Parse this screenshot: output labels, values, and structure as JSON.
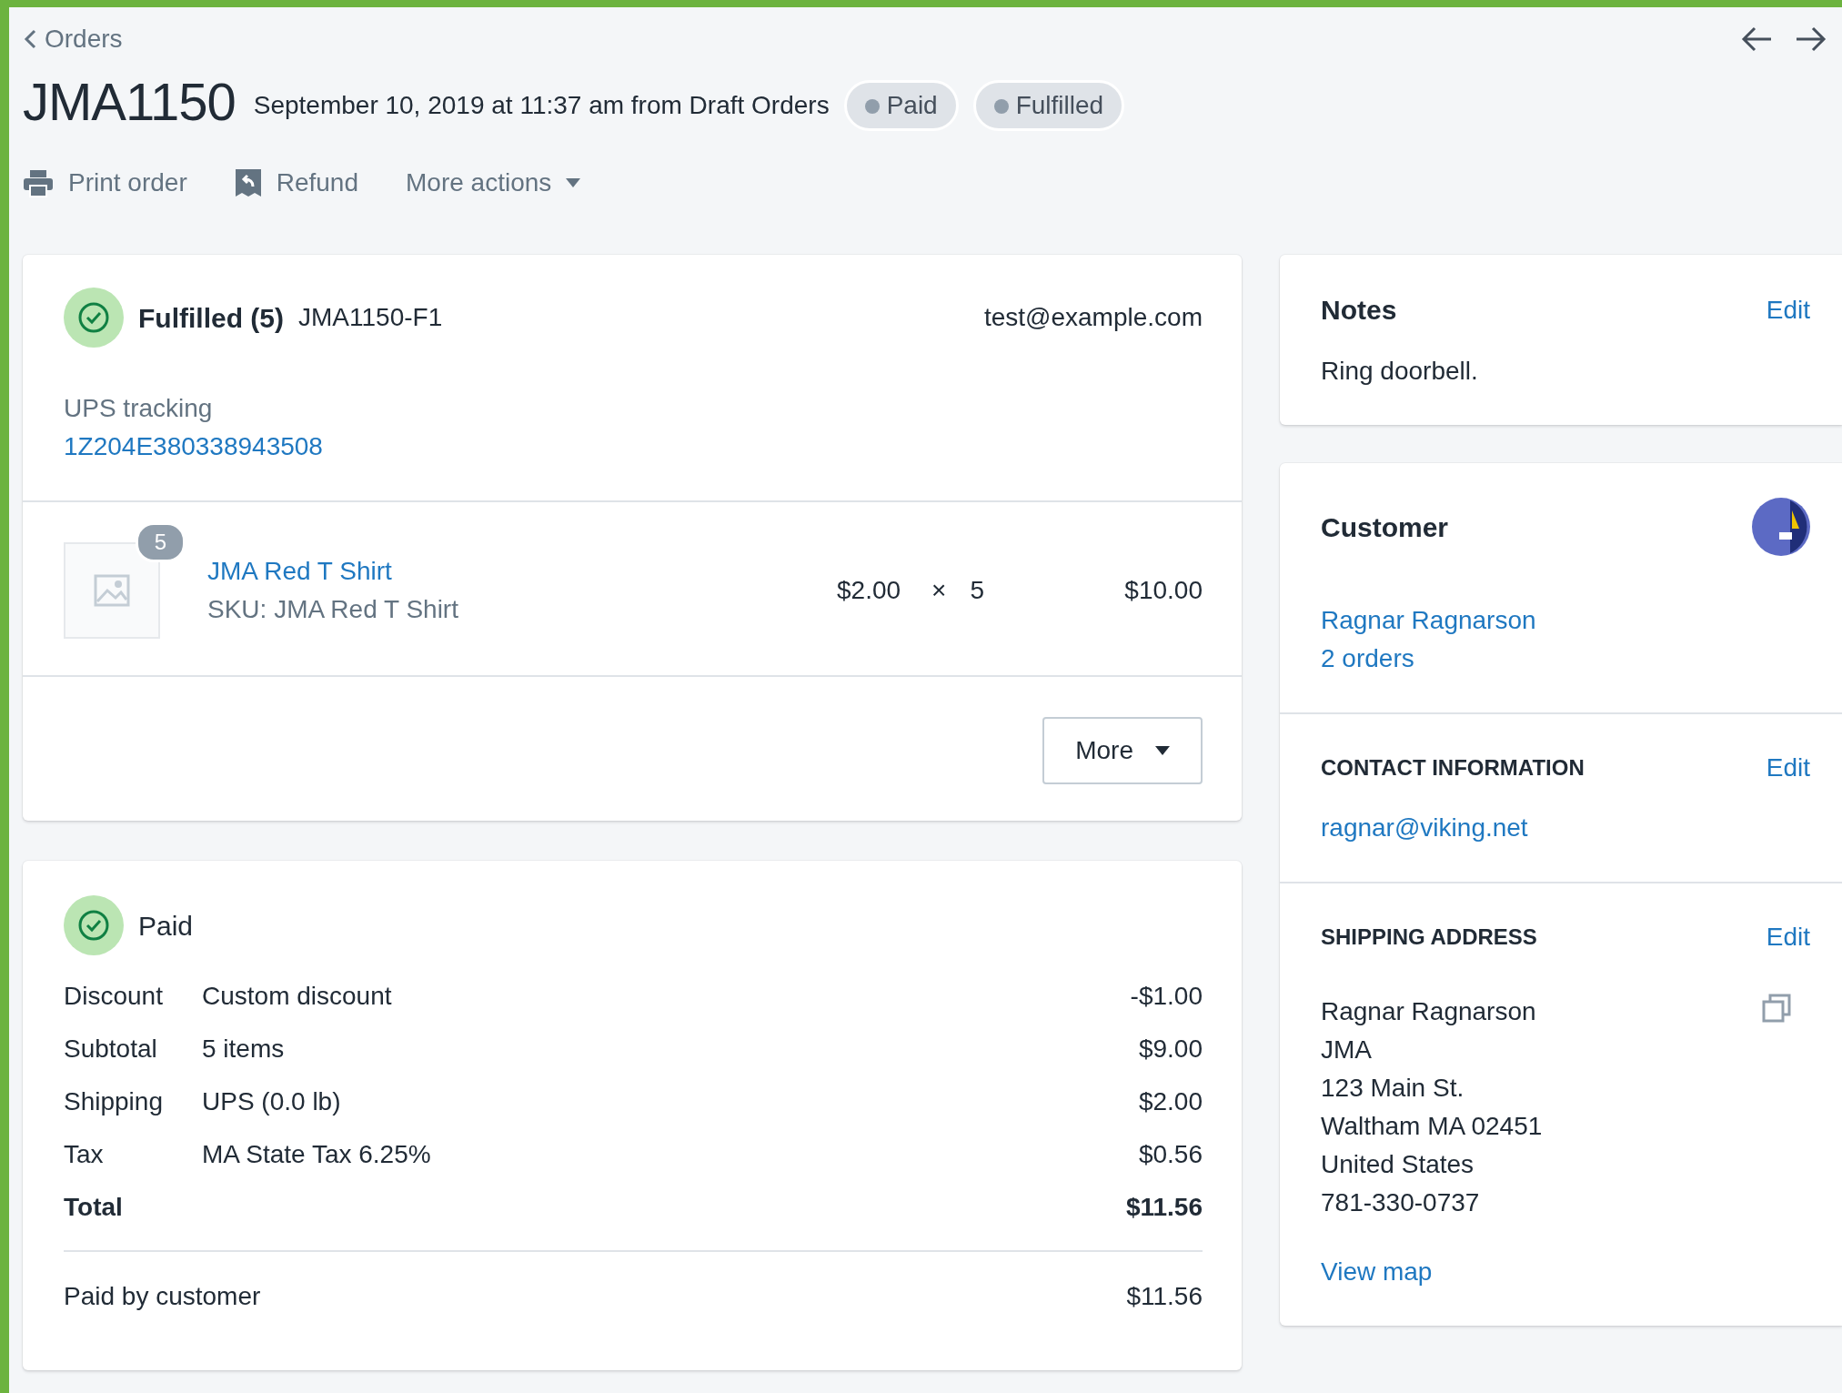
{
  "breadcrumb": {
    "label": "Orders"
  },
  "pager": [
    {
      "kind": "previous"
    },
    {
      "kind": "next"
    }
  ],
  "order": {
    "number": "JMA1150",
    "meta": "September 10, 2019 at 11:37 am from Draft Orders",
    "badges": [
      "Paid",
      "Fulfilled"
    ]
  },
  "actions": [
    {
      "kind": "print",
      "label": "Print order"
    },
    {
      "kind": "refund",
      "label": "Refund"
    },
    {
      "kind": "dropdown",
      "label": "More actions"
    }
  ],
  "fulfillment": {
    "title": "Fulfilled (5)",
    "code": "JMA1150-F1",
    "email": "test@example.com",
    "tracking_label": "UPS tracking",
    "tracking_number": "1Z204E380338943508",
    "items": [
      {
        "quantity_badge": "5",
        "name": "JMA Red T Shirt",
        "sku": "SKU: JMA Red T Shirt",
        "price": "$2.00",
        "times": "×",
        "quantity": "5",
        "total": "$10.00"
      }
    ],
    "more_button": "More"
  },
  "payment": {
    "title": "Paid",
    "lines": [
      {
        "kind": "line",
        "label": "Discount",
        "detail": "Custom discount",
        "amount": "-$1.00"
      },
      {
        "kind": "line",
        "label": "Subtotal",
        "detail": "5 items",
        "amount": "$9.00"
      },
      {
        "kind": "line",
        "label": "Shipping",
        "detail": "UPS (0.0 lb)",
        "amount": "$2.00"
      },
      {
        "kind": "line",
        "label": "Tax",
        "detail": "MA State Tax 6.25%",
        "amount": "$0.56"
      },
      {
        "kind": "total",
        "label": "Total",
        "amount": "$11.56"
      }
    ],
    "paid_by": {
      "label": "Paid by customer",
      "amount": "$11.56"
    }
  },
  "notes": {
    "title": "Notes",
    "edit": "Edit",
    "text": "Ring doorbell."
  },
  "customer": {
    "title": "Customer",
    "name": "Ragnar Ragnarson",
    "orders": "2 orders",
    "contact": {
      "title": "CONTACT INFORMATION",
      "edit": "Edit",
      "email": "ragnar@viking.net"
    },
    "shipping": {
      "title": "SHIPPING ADDRESS",
      "edit": "Edit",
      "lines": [
        "Ragnar Ragnarson",
        "JMA",
        "123 Main St.",
        "Waltham MA 02451",
        "United States",
        "781-330-0737"
      ],
      "map_link": "View map"
    }
  }
}
